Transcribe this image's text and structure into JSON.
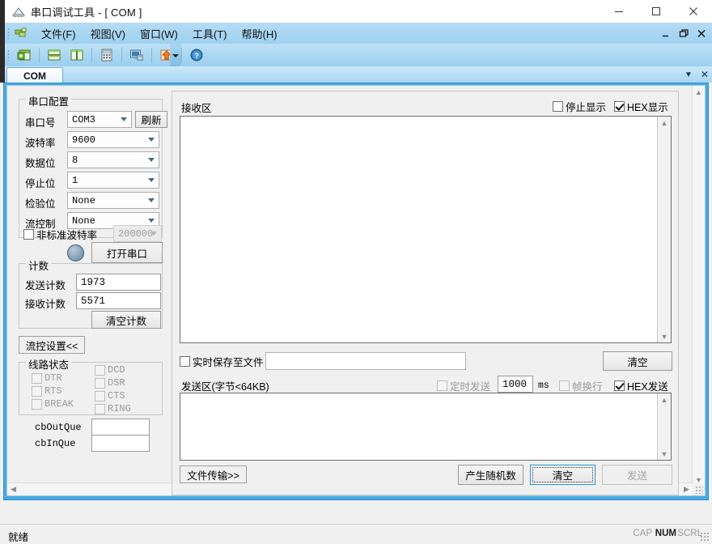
{
  "window": {
    "title": "串口调试工具 - [ COM ]",
    "icon": "app-serial-icon",
    "minimize": "—",
    "maximize": "□",
    "close": "✕"
  },
  "menu": {
    "items": [
      {
        "label": "文件(F)",
        "name": "menu-file"
      },
      {
        "label": "视图(V)",
        "name": "menu-view"
      },
      {
        "label": "窗口(W)",
        "name": "menu-window"
      },
      {
        "label": "工具(T)",
        "name": "menu-tools"
      },
      {
        "label": "帮助(H)",
        "name": "menu-help"
      }
    ],
    "mdi_minimize": "_",
    "mdi_restore": "❐",
    "mdi_close": "✕"
  },
  "toolbar": {
    "buttons": [
      {
        "name": "new-window-icon",
        "title": "新建"
      },
      {
        "name": "tile-horizontal-icon",
        "title": "横向平铺"
      },
      {
        "name": "tile-vertical-icon",
        "title": "纵向平铺"
      },
      {
        "name": "calculator-icon",
        "title": "计算器"
      },
      {
        "name": "monitor-icon",
        "title": "监视"
      },
      {
        "name": "upload-arrow-icon",
        "title": "上传"
      },
      {
        "name": "help-icon",
        "title": "帮助"
      }
    ]
  },
  "tabs": {
    "items": [
      {
        "label": "COM",
        "active": true
      }
    ],
    "dropdown_icon": "▼",
    "close_icon": "✕"
  },
  "config": {
    "group_title": "串口配置",
    "rows": [
      {
        "label": "串口号",
        "value": "COM3",
        "name": "port-select"
      },
      {
        "label": "波特率",
        "value": "9600",
        "name": "baudrate-select"
      },
      {
        "label": "数据位",
        "value": "8",
        "name": "databits-select"
      },
      {
        "label": "停止位",
        "value": "1",
        "name": "stopbits-select"
      },
      {
        "label": "检验位",
        "value": "None",
        "name": "parity-select"
      },
      {
        "label": "流控制",
        "value": "None",
        "name": "flowcontrol-select"
      }
    ],
    "refresh_button": "刷新",
    "custom_baud": {
      "label": "非标准波特率",
      "checked": false,
      "value": "200000",
      "enabled": false
    },
    "open_button": "打开串口",
    "led_state": "off"
  },
  "counter": {
    "group_title": "计数",
    "tx_label": "发送计数",
    "tx_value": "1973",
    "rx_label": "接收计数",
    "rx_value": "5571",
    "clear_button": "清空计数"
  },
  "flow": {
    "settings_button": "流控设置<<",
    "line_state_title": "线路状态",
    "left_checks": [
      {
        "label": "DTR",
        "checked": false
      },
      {
        "label": "RTS",
        "checked": false
      },
      {
        "label": "BREAK",
        "checked": false
      }
    ],
    "right_checks": [
      {
        "label": "DCD",
        "checked": false
      },
      {
        "label": "DSR",
        "checked": false
      },
      {
        "label": "CTS",
        "checked": false
      },
      {
        "label": "RING",
        "checked": false
      }
    ],
    "queues": [
      {
        "label": "cbOutQue",
        "value": ""
      },
      {
        "label": "cbInQue",
        "value": ""
      }
    ]
  },
  "receive": {
    "title": "接收区",
    "stop_display": {
      "label": "停止显示",
      "checked": false
    },
    "hex_display": {
      "label": "HEX显示",
      "checked": true
    },
    "content": "",
    "save_to_file": {
      "label": "实时保存至文件",
      "checked": false,
      "path": ""
    },
    "clear_button": "清空"
  },
  "send": {
    "title": "发送区(字节<64KB)",
    "timed_send": {
      "label": "定时发送",
      "checked": false
    },
    "interval_value": "1000",
    "interval_unit": "ms",
    "frame_newline": {
      "label": "帧换行",
      "checked": false
    },
    "hex_send": {
      "label": "HEX发送",
      "checked": true
    },
    "content": "",
    "file_transfer_button": "文件传输>>",
    "random_button": "产生随机数",
    "clear_button": "清空",
    "send_button": "发送",
    "send_enabled": false
  },
  "statusbar": {
    "message": "就绪",
    "indicators": [
      {
        "label": "CAP",
        "active": false
      },
      {
        "label": "NUM",
        "active": true
      },
      {
        "label": "SCRL",
        "active": false
      }
    ]
  },
  "colors": {
    "accent": "#4aa8e0",
    "menu_blue": "#a9d6f2",
    "panel": "#f0f0f0",
    "focus": "#1e8fd5"
  }
}
